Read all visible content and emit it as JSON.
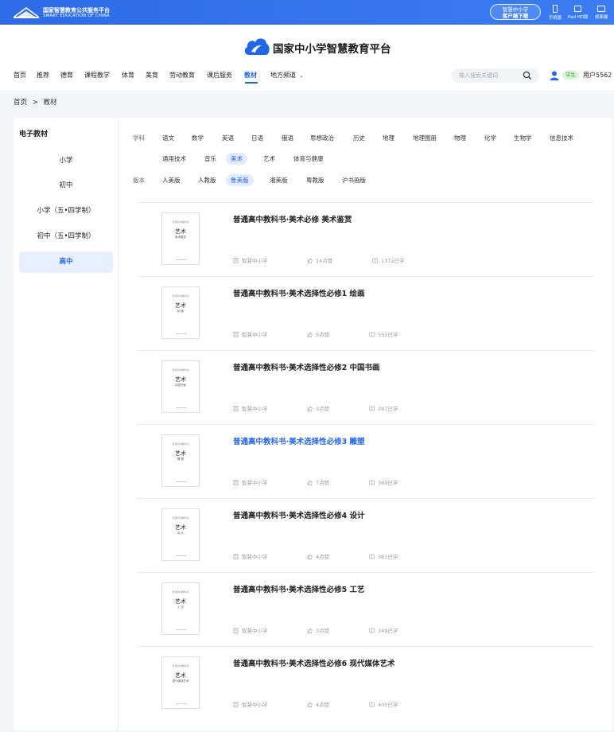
{
  "topbar": {
    "logo_cn": "国家智慧教育公共服务平台",
    "logo_en": "SMART EDUCATION OF CHINA",
    "download_line1": "智慧中小学",
    "download_line2": "客户端下载",
    "devices": [
      {
        "label": "手机版",
        "icon": "phone-icon"
      },
      {
        "label": "Pad HD版",
        "icon": "tablet-icon"
      },
      {
        "label": "桌面端",
        "icon": "desktop-icon"
      }
    ]
  },
  "header": {
    "brand": "国家中小学智慧教育平台",
    "nav": [
      "首页",
      "推荐",
      "德育",
      "课程教学",
      "体育",
      "美育",
      "劳动教育",
      "课后服务",
      "教材",
      "地方频道"
    ],
    "nav_active": "教材",
    "search_placeholder": "输入搜索关键词",
    "role": "学生",
    "user": "用户5562"
  },
  "breadcrumb": {
    "home": "首页",
    "sep": ">",
    "current": "教材"
  },
  "sidebar": {
    "title": "电子教材",
    "items": [
      "小学",
      "初中",
      "小学（五•四学制）",
      "初中（五•四学制）",
      "高中"
    ],
    "active": "高中"
  },
  "filters": {
    "subject_label": "学科",
    "subjects_row1": [
      "语文",
      "数学",
      "英语",
      "日语",
      "俄语",
      "思想政治",
      "历史",
      "地理",
      "地理图册",
      "物理",
      "化学",
      "生物学",
      "信息技术"
    ],
    "subjects_row2": [
      "通用技术",
      "音乐",
      "美术",
      "艺术",
      "体育与健康"
    ],
    "subject_active": "美术",
    "edition_label": "版本",
    "editions": [
      "人美版",
      "人教版",
      "鲁美版",
      "湘美版",
      "粤教版",
      "沪书画版"
    ],
    "edition_active": "鲁美版"
  },
  "books": [
    {
      "title": "普通高中教科书·美术必修 美术鉴赏",
      "publisher": "智慧中小学",
      "likes": "14点赞",
      "learners": "1372已学",
      "cover_sub": "美术鉴赏",
      "highlight": false
    },
    {
      "title": "普通高中教科书·美术选择性必修1 绘画",
      "publisher": "智慧中小学",
      "likes": "5点赞",
      "learners": "551已学",
      "cover_sub": "绘 画",
      "highlight": false
    },
    {
      "title": "普通高中教科书·美术选择性必修2 中国书画",
      "publisher": "智慧中小学",
      "likes": "3点赞",
      "learners": "397已学",
      "cover_sub": "中国书画",
      "highlight": false
    },
    {
      "title": "普通高中教科书·美术选择性必修3 雕塑",
      "publisher": "智慧中小学",
      "likes": "7点赞",
      "learners": "369已学",
      "cover_sub": "雕 塑",
      "highlight": true
    },
    {
      "title": "普通高中教科书·美术选择性必修4 设计",
      "publisher": "智慧中小学",
      "likes": "4点赞",
      "learners": "361已学",
      "cover_sub": "设 计",
      "highlight": false
    },
    {
      "title": "普通高中教科书·美术选择性必修5 工艺",
      "publisher": "智慧中小学",
      "likes": "3点赞",
      "learners": "349已学",
      "cover_sub": "工 艺",
      "highlight": false
    },
    {
      "title": "普通高中教科书·美术选择性必修6 现代媒体艺术",
      "publisher": "智慧中小学",
      "likes": "4点赞",
      "learners": "400已学",
      "cover_sub": "现代媒体艺术",
      "highlight": false
    }
  ],
  "cover_text": {
    "top": "普通高中教科书",
    "art": "艺术"
  },
  "colors": {
    "brand": "#2d6be8",
    "accent": "#2466e8",
    "active_bg": "#e8efff",
    "role_bg": "#d7f5d7"
  }
}
